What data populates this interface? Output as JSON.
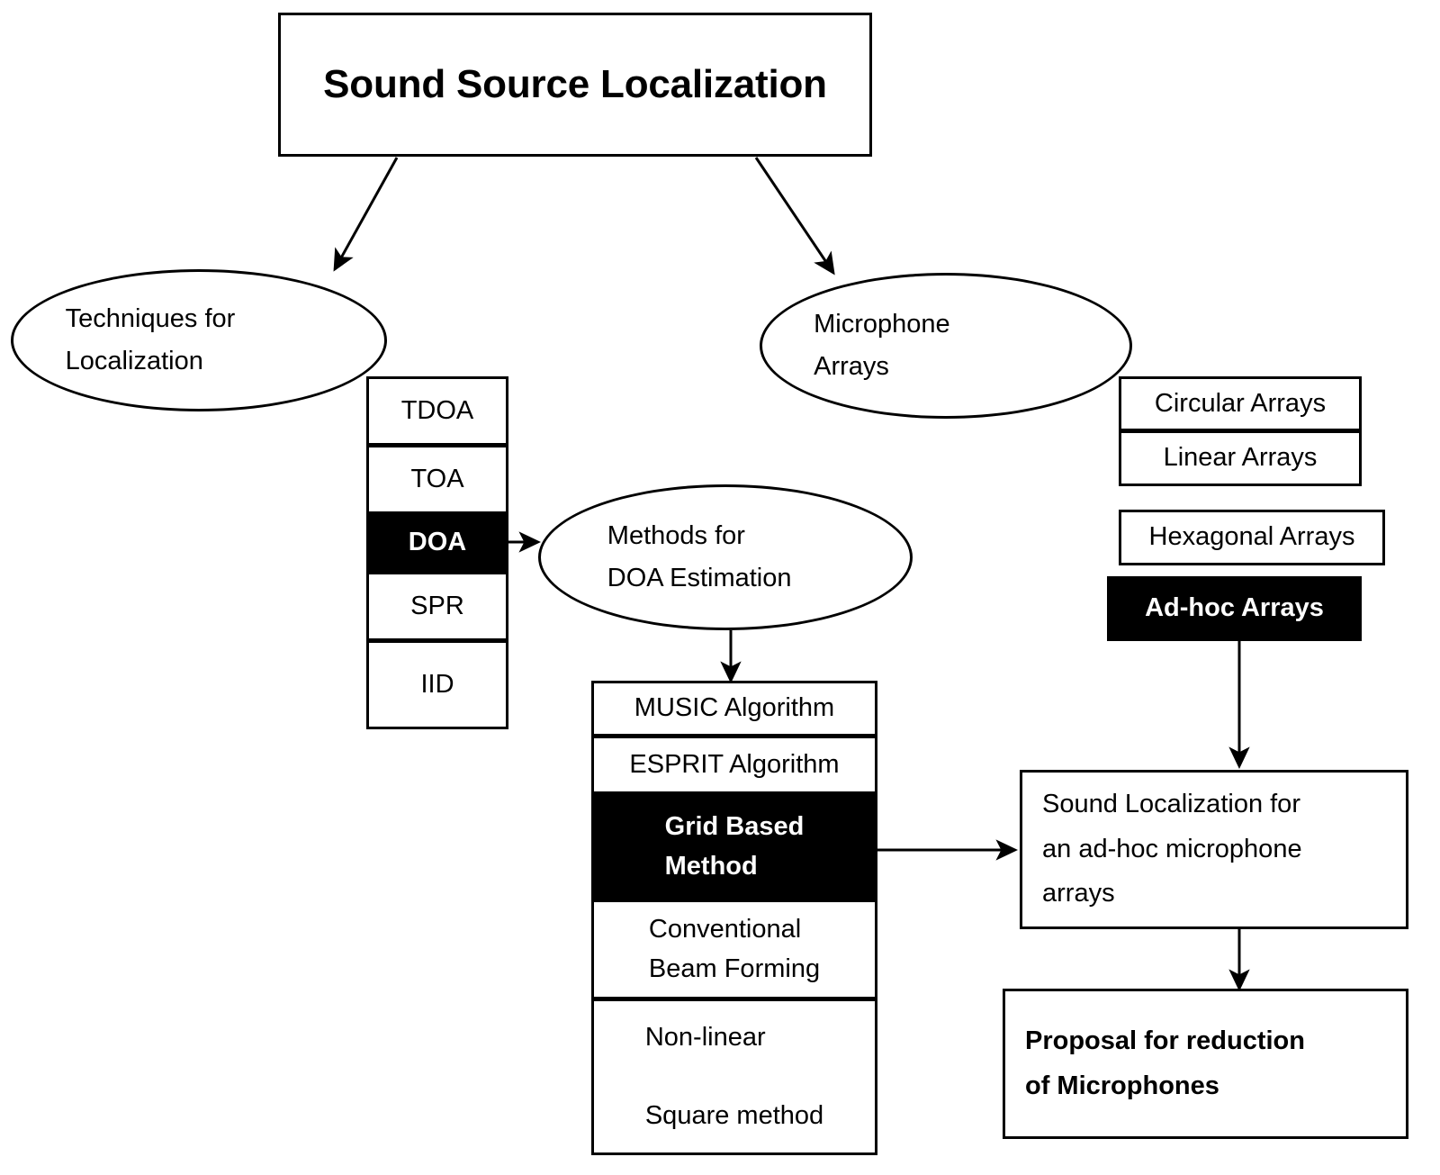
{
  "diagram": {
    "title": "Sound Source Localization",
    "root": {
      "label": "Sound Source Localization"
    },
    "branches": {
      "techniques_ellipse": {
        "label": "Techniques for\nLocalization"
      },
      "mic_arrays_ellipse": {
        "label": "Microphone\nArrays"
      },
      "doa_methods_ellipse": {
        "label": "Methods for\nDOA Estimation"
      }
    },
    "techniques_list": [
      {
        "label": "TDOA",
        "highlighted": false
      },
      {
        "label": "TOA",
        "highlighted": false
      },
      {
        "label": "DOA",
        "highlighted": true
      },
      {
        "label": "SPR",
        "highlighted": false
      },
      {
        "label": "IID",
        "highlighted": false
      }
    ],
    "array_types_list": [
      {
        "label": "Circular Arrays",
        "highlighted": false
      },
      {
        "label": "Linear Arrays",
        "highlighted": false
      },
      {
        "label": "Hexagonal Arrays",
        "highlighted": false
      },
      {
        "label": "Ad-hoc Arrays",
        "highlighted": true
      }
    ],
    "doa_methods_list": [
      {
        "label": "MUSIC Algorithm",
        "highlighted": false
      },
      {
        "label": "ESPRIT Algorithm",
        "highlighted": false
      },
      {
        "label": "Grid Based\nMethod",
        "highlighted": true
      },
      {
        "label": "Conventional\nBeam Forming",
        "highlighted": false
      },
      {
        "label": "Non-linear\n\nSquare method",
        "highlighted": false
      }
    ],
    "outcomes": {
      "sound_localization": {
        "label": "Sound Localization for\nan ad-hoc microphone\narrays",
        "bold": false
      },
      "proposal": {
        "label": "Proposal for reduction\nof Microphones",
        "bold": true
      }
    },
    "colors": {
      "stroke": "#000000",
      "highlight_fill": "#000000",
      "highlight_text": "#ffffff",
      "background": "#ffffff"
    }
  }
}
